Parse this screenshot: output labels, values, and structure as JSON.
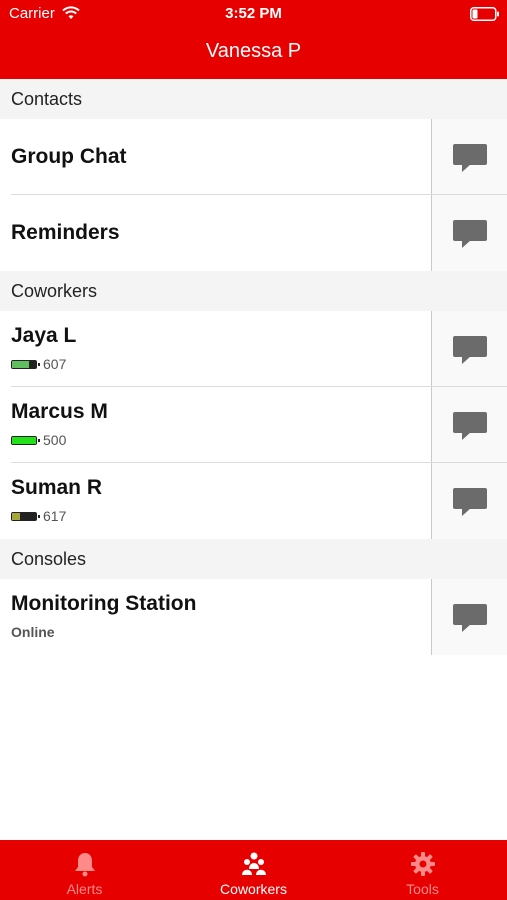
{
  "status_bar": {
    "carrier": "Carrier",
    "time": "3:52 PM"
  },
  "nav": {
    "title": "Vanessa P"
  },
  "sections": {
    "contacts": {
      "header": "Contacts",
      "items": [
        {
          "name": "Group Chat"
        },
        {
          "name": "Reminders"
        }
      ]
    },
    "coworkers": {
      "header": "Coworkers",
      "items": [
        {
          "name": "Jaya L",
          "value": "607",
          "battery_level": 0.7,
          "battery_color": "#5fbf5f"
        },
        {
          "name": "Marcus M",
          "value": "500",
          "battery_level": 1.0,
          "battery_color": "#22e01a"
        },
        {
          "name": "Suman R",
          "value": "617",
          "battery_level": 0.35,
          "battery_color": "#a6a63a"
        }
      ]
    },
    "consoles": {
      "header": "Consoles",
      "items": [
        {
          "name": "Monitoring Station",
          "status": "Online"
        }
      ]
    }
  },
  "tabs": [
    {
      "label": "Alerts",
      "icon": "bell-icon",
      "active": false
    },
    {
      "label": "Coworkers",
      "icon": "people-icon",
      "active": true
    },
    {
      "label": "Tools",
      "icon": "gear-icon",
      "active": false
    }
  ],
  "colors": {
    "brand_red": "#e60000",
    "chat_icon": "#6b6b6b"
  }
}
